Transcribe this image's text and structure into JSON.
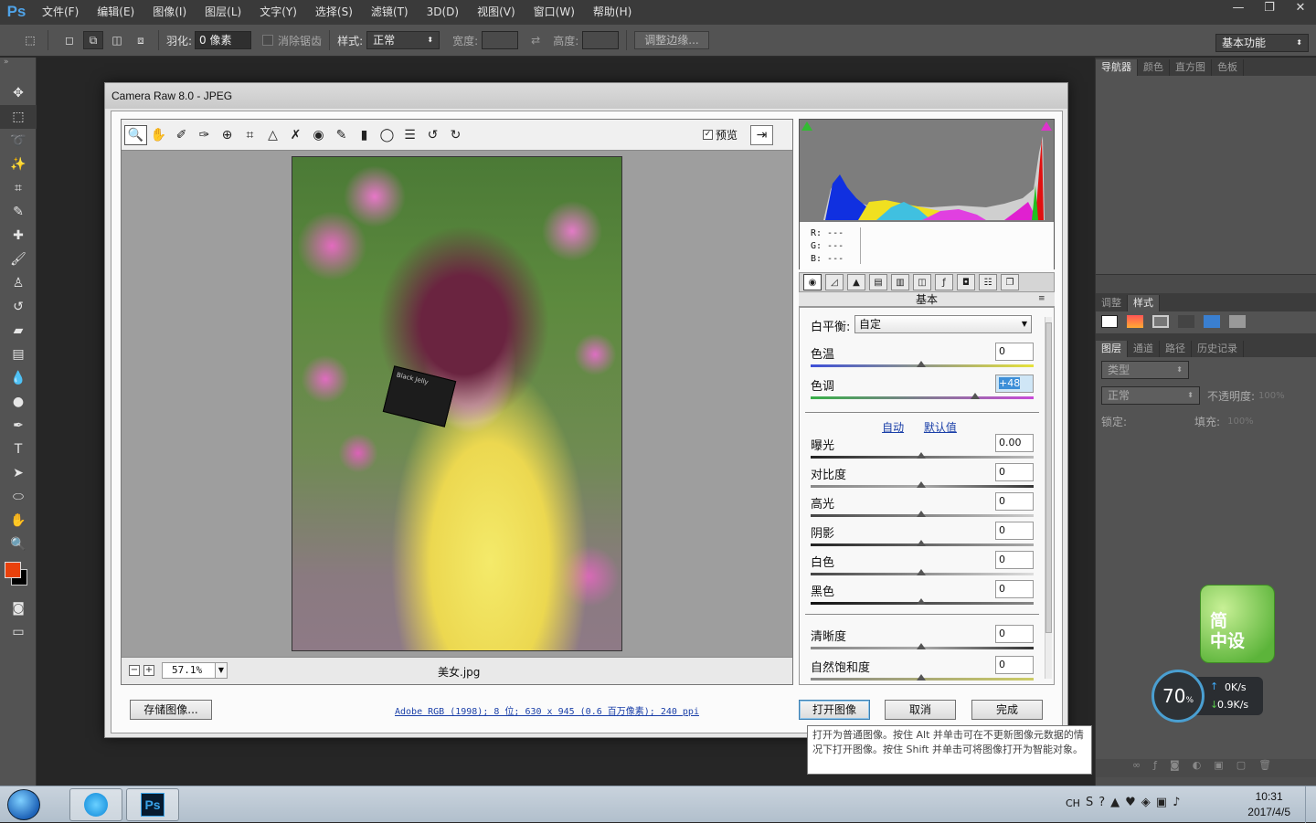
{
  "app": {
    "logo": "Ps"
  },
  "menu": [
    "文件(F)",
    "编辑(E)",
    "图像(I)",
    "图层(L)",
    "文字(Y)",
    "选择(S)",
    "滤镜(T)",
    "3D(D)",
    "视图(V)",
    "窗口(W)",
    "帮助(H)"
  ],
  "window_controls": {
    "minimize": "—",
    "restore": "❐",
    "close": "✕"
  },
  "options": {
    "feather_label": "羽化:",
    "feather_value": "0 像素",
    "antialias_label": "消除锯齿",
    "style_label": "样式:",
    "style_value": "正常",
    "width_label": "宽度:",
    "height_label": "高度:",
    "refine_edge": "调整边缘...",
    "workspace": "基本功能"
  },
  "right_panels": {
    "top_tabs": [
      "导航器",
      "颜色",
      "直方图",
      "色板"
    ],
    "mid_tabs": [
      "调整",
      "样式"
    ],
    "layer_tabs": [
      "图层",
      "通道",
      "路径",
      "历史记录"
    ],
    "kind_label": "类型",
    "blend_mode": "正常",
    "opacity_label": "不透明度:",
    "opacity_value": "100%",
    "lock_label": "锁定:",
    "fill_label": "填充:",
    "fill_value": "100%"
  },
  "dialog": {
    "title": "Camera Raw 8.0 -  JPEG",
    "preview_label": "预览",
    "zoom_value": "57.1%",
    "filename": "美女.jpg",
    "photo_card_text": "Black Jelly",
    "histogram": {
      "r": "R:  ---",
      "g": "G:  ---",
      "b": "B:  ---"
    },
    "panel_title": "基本",
    "white_balance_label": "白平衡:",
    "white_balance_value": "自定",
    "temp_label": "色温",
    "temp_value": "0",
    "tint_label": "色调",
    "tint_value": "+48",
    "auto_link": "自动",
    "default_link": "默认值",
    "exposure_label": "曝光",
    "exposure_value": "0.00",
    "contrast_label": "对比度",
    "contrast_value": "0",
    "highlights_label": "高光",
    "highlights_value": "0",
    "shadows_label": "阴影",
    "shadows_value": "0",
    "whites_label": "白色",
    "whites_value": "0",
    "blacks_label": "黑色",
    "blacks_value": "0",
    "clarity_label": "清晰度",
    "clarity_value": "0",
    "vibrance_label": "自然饱和度",
    "vibrance_value": "0",
    "save_button": "存储图像...",
    "workflow_link": "Adobe RGB (1998); 8 位; 630 x 945 (0.6 百万像素); 240 ppi",
    "open_button": "打开图像",
    "cancel_button": "取消",
    "done_button": "完成",
    "tooltip": "打开为普通图像。按住 Alt 并单击可在不更新图像元数据的情况下打开图像。按住 Shift 并单击可将图像打开为智能对象。"
  },
  "widget": {
    "logo_text_1": "简",
    "logo_text_2": "中设",
    "percent": "70",
    "percent_unit": "%",
    "up_speed": "0K/s",
    "down_speed": "0.9K/s"
  },
  "taskbar": {
    "lang": "CH",
    "time": "10:31",
    "date": "2017/4/5",
    "ps_label": "Ps"
  },
  "colors": {
    "foreground": "#e8410c",
    "background": "#000000",
    "accent_link": "#1a3fa8"
  }
}
